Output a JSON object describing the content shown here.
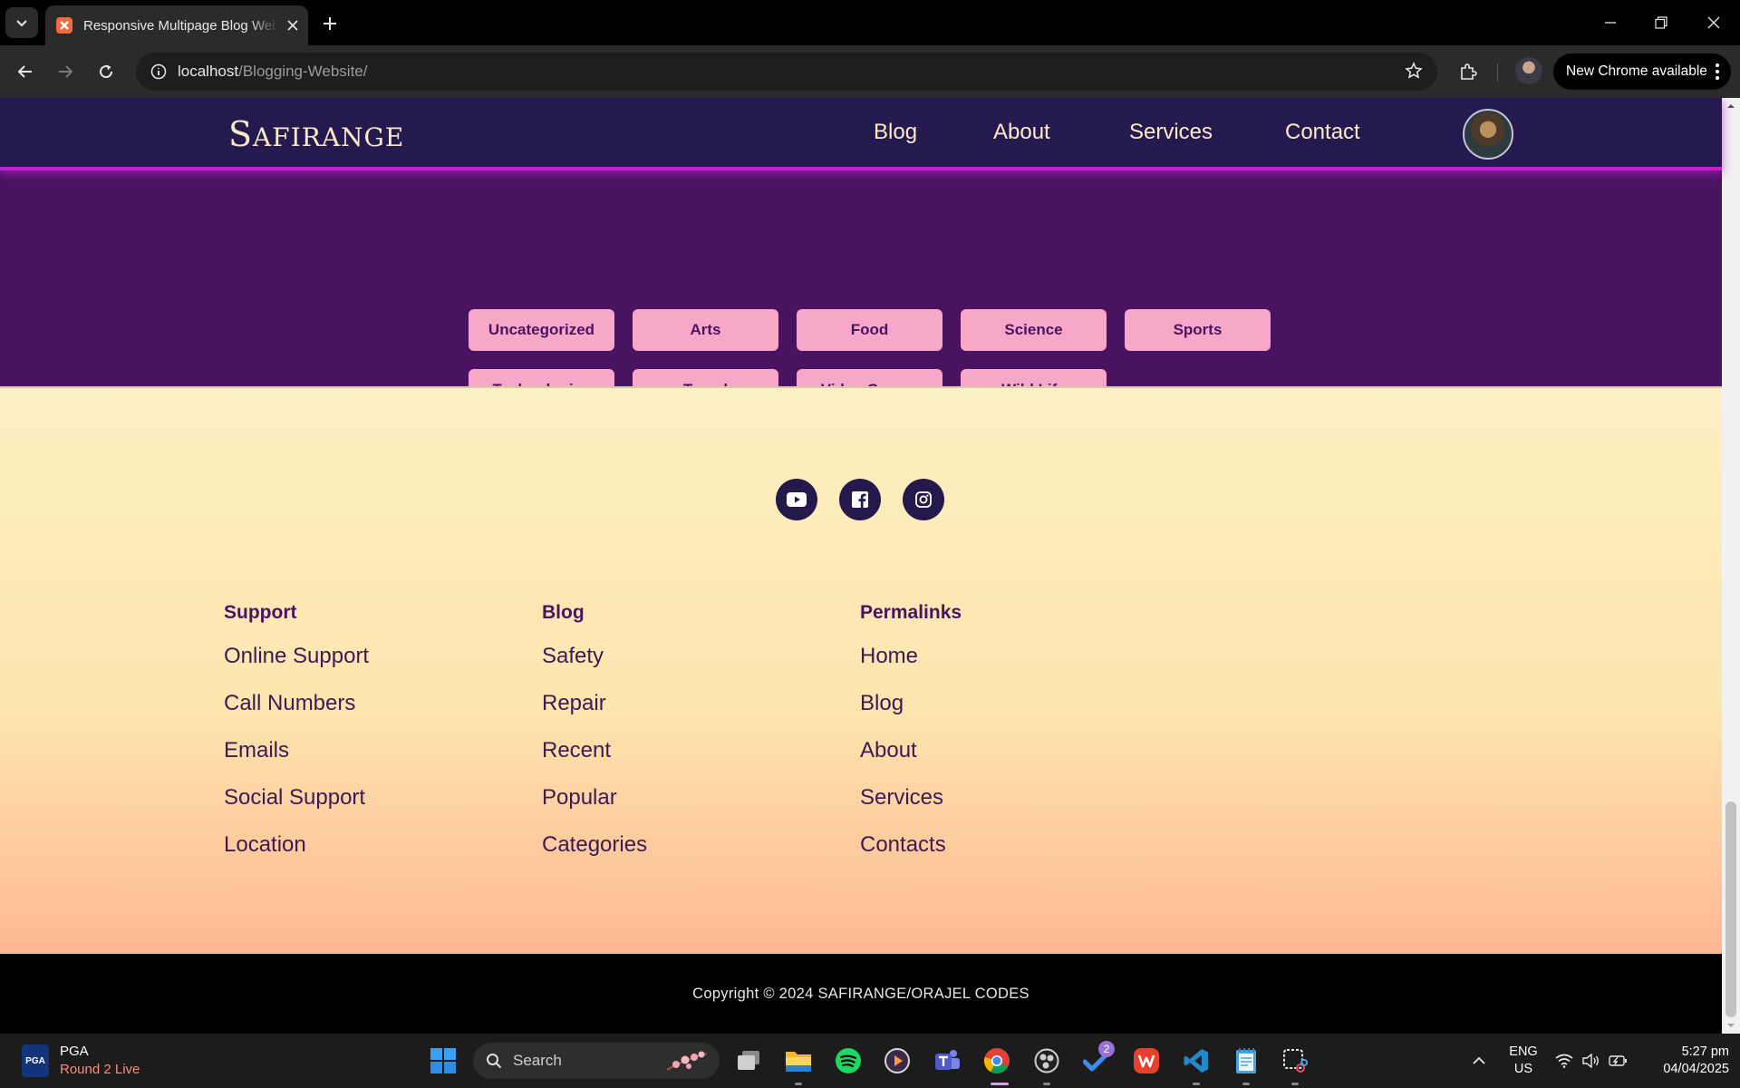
{
  "browser": {
    "tab_title": "Responsive Multipage Blog Website",
    "url_host": "localhost",
    "url_path": "/Blogging-Website/",
    "update_label": "New Chrome available"
  },
  "site": {
    "logo_first": "S",
    "logo_rest": "AFIRANGE",
    "nav": [
      "Blog",
      "About",
      "Services",
      "Contact"
    ]
  },
  "categories": [
    "Uncategorized",
    "Arts",
    "Food",
    "Science",
    "Sports",
    "Technologies",
    "Travel",
    "Video Games",
    "Wild Life"
  ],
  "social": [
    "youtube-icon",
    "facebook-icon",
    "instagram-icon"
  ],
  "footer_columns": [
    {
      "heading": "Support",
      "links": [
        "Online Support",
        "Call Numbers",
        "Emails",
        "Social Support",
        "Location"
      ]
    },
    {
      "heading": "Blog",
      "links": [
        "Safety",
        "Repair",
        "Recent",
        "Popular",
        "Categories"
      ]
    },
    {
      "heading": "Permalinks",
      "links": [
        "Home",
        "Blog",
        "About",
        "Services",
        "Contacts"
      ]
    }
  ],
  "copyright": "Copyright © 2024 SAFIRANGE/ORAJEL CODES",
  "taskbar": {
    "widget_title": "PGA",
    "widget_subtitle": "Round 2 Live",
    "search_label": "Search",
    "todo_badge": "2",
    "lang_top": "ENG",
    "lang_bottom": "US",
    "time": "5:27 pm",
    "date": "04/04/2025"
  },
  "colors": {
    "header_bg": "#251a50",
    "header_border": "#c11fcf",
    "categories_bg": "#4a1362",
    "category_button": "#f7a8c8",
    "footer_gradient_top": "#fdf0c4",
    "footer_gradient_bottom": "#ffa585",
    "logo": "#fbe9c4"
  }
}
